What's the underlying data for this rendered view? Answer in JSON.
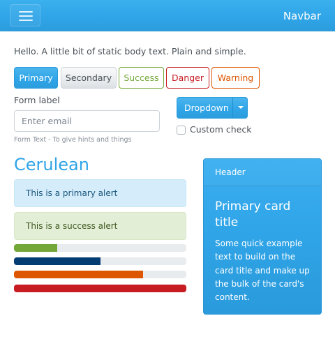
{
  "navbar": {
    "brand": "Navbar",
    "toggler_icon": "hamburger-icon"
  },
  "body_text": "Hello. A little bit of static body text. Plain and simple.",
  "buttons": {
    "primary": "Primary",
    "secondary": "Secondary",
    "success": "Success",
    "danger": "Danger",
    "warning": "Warning"
  },
  "form": {
    "label": "Form label",
    "placeholder": "Enter email",
    "help": "Form Text - To give hints and things"
  },
  "dropdown": {
    "label": "Dropdown",
    "caret_icon": "caret-down-icon"
  },
  "checkbox": {
    "label": "Custom check",
    "checked": false
  },
  "heading": "Cerulean",
  "alerts": {
    "primary": "This is a primary alert",
    "success": "This is a success alert"
  },
  "progress": [
    {
      "value": 25,
      "color": "#73a839"
    },
    {
      "value": 50,
      "color": "#033c73"
    },
    {
      "value": 75,
      "color": "#dd5600"
    },
    {
      "value": 100,
      "color": "#c71c22"
    }
  ],
  "card": {
    "header": "Header",
    "title": "Primary card title",
    "text": "Some quick example text to build on the card title and make up the bulk of the card's content."
  },
  "colors": {
    "primary": "#2fa4e7",
    "success": "#73a839",
    "danger": "#c71c22",
    "warning": "#dd5600",
    "dark_blue": "#033c73"
  }
}
